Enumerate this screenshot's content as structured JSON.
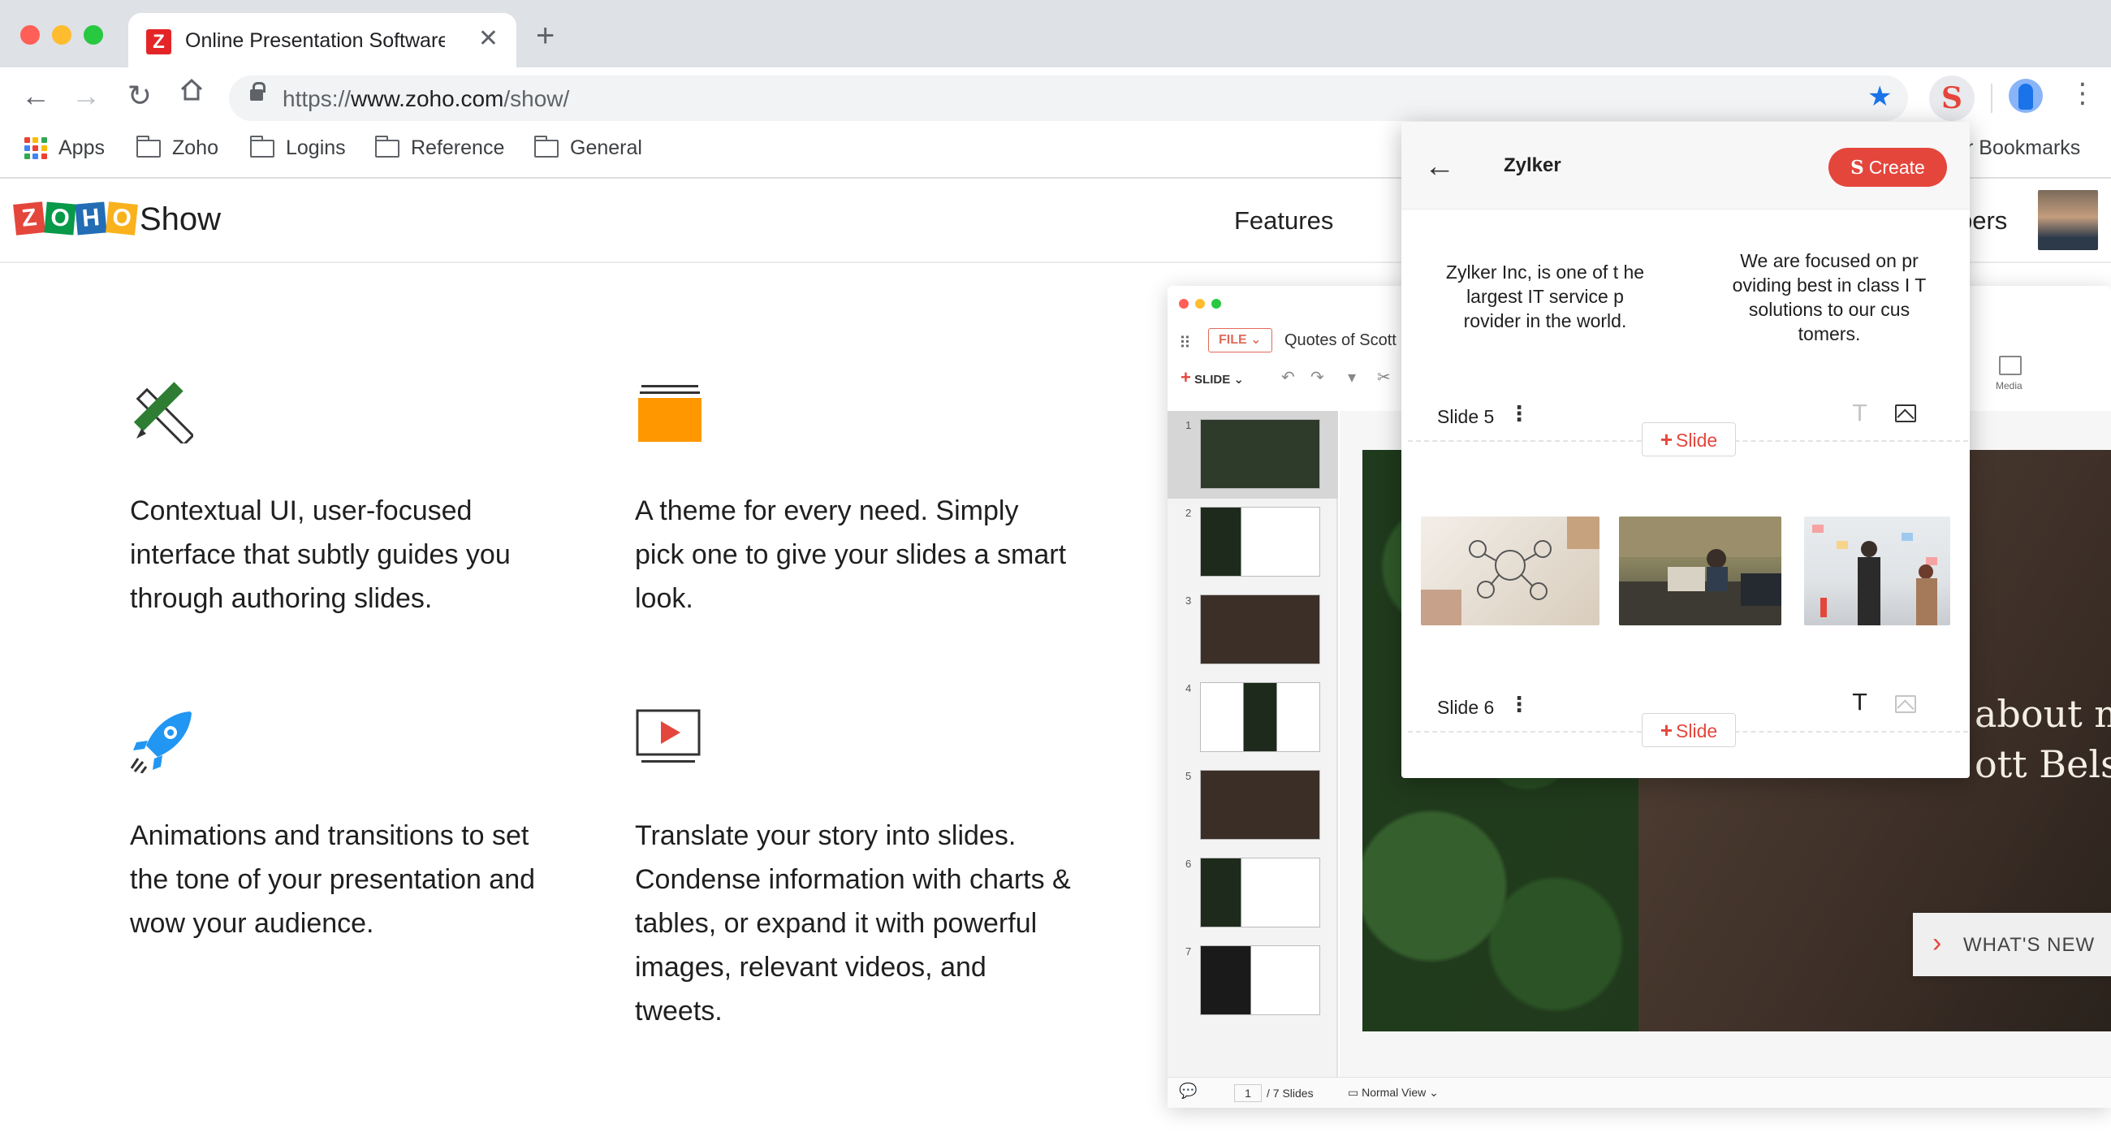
{
  "browser": {
    "tab_title": "Online Presentation Software |",
    "url_prefix": "https://",
    "url_host": "www.zoho.com",
    "url_path": "/show/",
    "bookmarks": [
      {
        "label": "Apps"
      },
      {
        "label": "Zoho"
      },
      {
        "label": "Logins"
      },
      {
        "label": "Reference"
      },
      {
        "label": "General"
      }
    ],
    "other_bookmarks": "r Bookmarks"
  },
  "site": {
    "logo_letters": [
      "Z",
      "O",
      "H",
      "O"
    ],
    "product": "Show",
    "nav_features": "Features",
    "nav_partial": "pers"
  },
  "features": [
    {
      "text": "Contextual UI, user-focused interface that subtly guides you through authoring slides."
    },
    {
      "text": "A theme for every need. Simply pick one to give your slides a smart look."
    },
    {
      "text": "Animations and transitions to set the tone of your presentation and wow your audience."
    },
    {
      "text": "Translate your story into slides. Condense information with charts & tables, or expand it with powerful images, relevant videos, and tweets."
    }
  ],
  "app": {
    "file_label": "FILE",
    "doc_title": "Quotes of Scott",
    "slide_label": "SLIDE",
    "media_label": "Media",
    "thumb_numbers": [
      "1",
      "2",
      "3",
      "4",
      "5",
      "6",
      "7"
    ],
    "current_page": "1",
    "total_slides": "/ 7 Slides",
    "view_mode": "Normal View",
    "slide_text_line1": "about mo",
    "slide_text_line2": "ott Belsky",
    "whats_new": "WHAT'S NEW"
  },
  "popup": {
    "title": "Zylker",
    "create_label": "Create",
    "text_left": "Zylker Inc, is one of t he largest IT service p rovider in the world.",
    "text_right": "We are focused on pr oviding best in class I T solutions to our cus tomers.",
    "slides": [
      {
        "label": "Slide 5",
        "add_label": "Slide"
      },
      {
        "label": "Slide 6",
        "add_label": "Slide"
      }
    ]
  },
  "colors": {
    "accent_red": "#e4463c",
    "chrome_bg": "#dee1e6",
    "star_blue": "#1a73e8",
    "theme_orange": "#ff9800",
    "rocket_blue": "#2196f3",
    "pencil_green": "#2e7d32"
  },
  "icons": {
    "feature_1": "pencil-ruler-icon",
    "feature_2": "folder-stack-icon",
    "feature_3": "rocket-icon",
    "feature_4": "video-play-icon"
  }
}
